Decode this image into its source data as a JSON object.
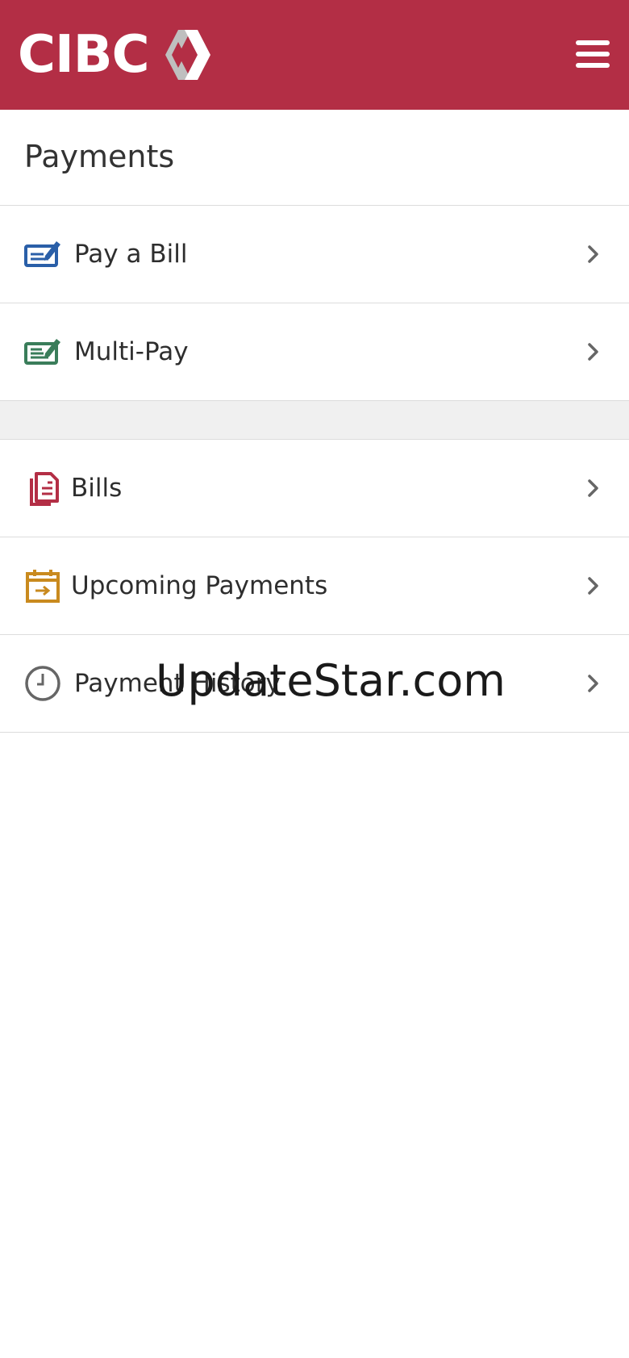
{
  "header": {
    "brand": "CIBC",
    "brand_color": "#b32e45",
    "menu_icon": "hamburger-menu-icon"
  },
  "page": {
    "title": "Payments"
  },
  "primary_actions": [
    {
      "label": "Pay a Bill",
      "icon": "pay-bill-icon",
      "icon_color": "#2a5fa8"
    },
    {
      "label": "Multi-Pay",
      "icon": "multi-pay-icon",
      "icon_color": "#3a7d5a"
    }
  ],
  "secondary_actions": [
    {
      "label": "Bills",
      "icon": "bills-document-icon",
      "icon_color": "#b32e45"
    },
    {
      "label": "Upcoming Payments",
      "icon": "calendar-arrow-icon",
      "icon_color": "#c98a1e"
    },
    {
      "label": "Payment History",
      "icon": "clock-icon",
      "icon_color": "#666666"
    }
  ],
  "watermark": {
    "text": "UpdateStar.com"
  }
}
